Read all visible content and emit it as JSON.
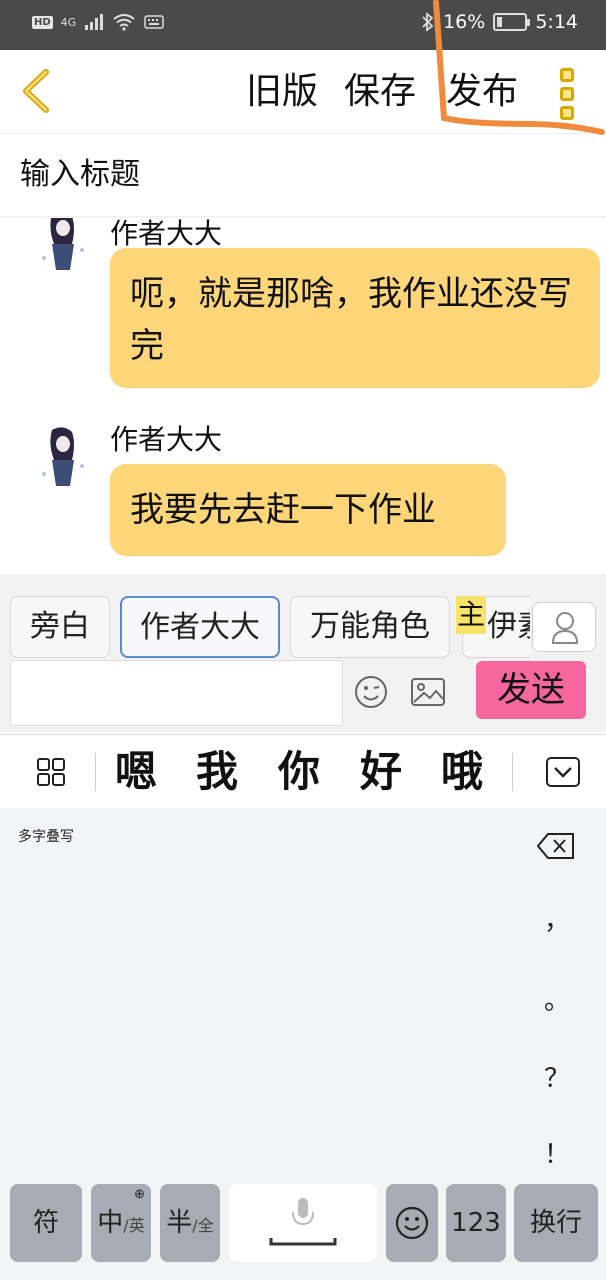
{
  "status_bar": {
    "left_chip": "HD",
    "network": "4G",
    "battery_text": "16%",
    "battery_level": 0.16,
    "time": "5:14"
  },
  "toolbar": {
    "back_icon": "chevron-left-icon",
    "old_version_label": "旧版",
    "save_label": "保存",
    "publish_label": "发布",
    "menu_icon": "more-vertical-icon",
    "accent_color": "#f4c534"
  },
  "title_field": {
    "placeholder": "输入标题"
  },
  "chat": {
    "messages": [
      {
        "author": "作者大大",
        "text": "呃，就是那啥，我作业还没写完"
      },
      {
        "author": "作者大大",
        "text": "我要先去赶一下作业"
      }
    ],
    "bubble_color": "#fdd67a"
  },
  "roles": {
    "items": [
      "旁白",
      "作者大大",
      "万能角色",
      "伊素"
    ],
    "selected": "作者大大",
    "badge": "主"
  },
  "composer": {
    "input_value": "",
    "send_label": "发送",
    "send_color": "#f7679f"
  },
  "candidates": {
    "items": [
      "嗯",
      "我",
      "你",
      "好",
      "哦"
    ]
  },
  "keyboard": {
    "mode_label": "多字叠写",
    "punctuation": [
      "，",
      "。",
      "？",
      "！"
    ],
    "keys": {
      "symbols": "符",
      "zh": "中",
      "en": "/英",
      "half": "半",
      "full": "/全",
      "numbers": "123",
      "newline": "换行"
    }
  }
}
